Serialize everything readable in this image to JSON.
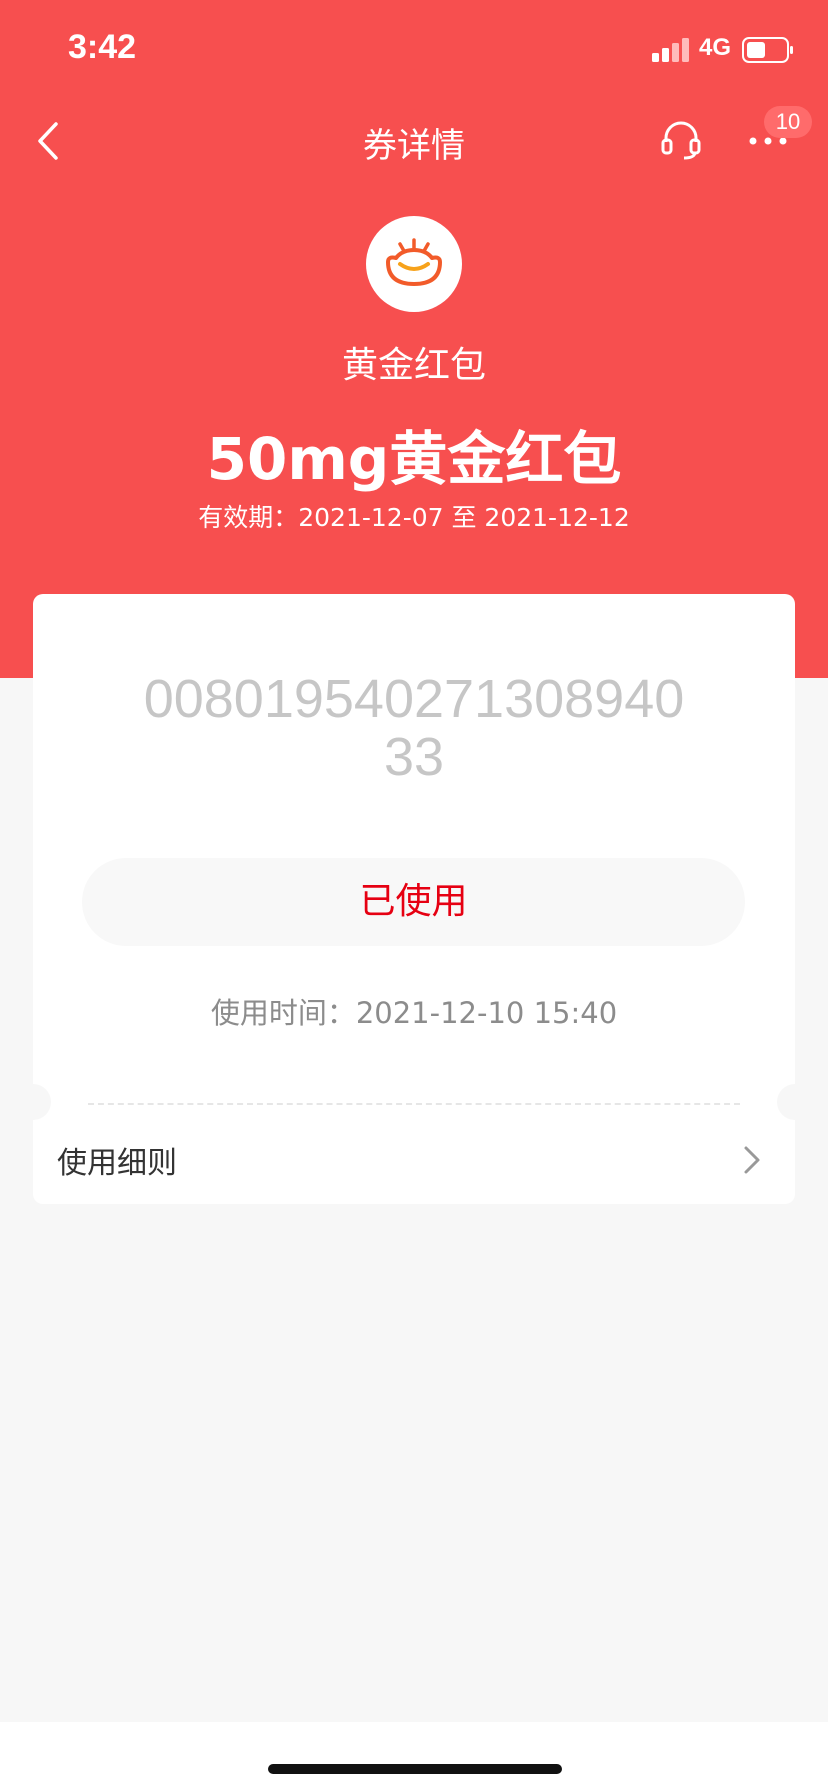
{
  "status_bar": {
    "time": "3:42",
    "network": "4G"
  },
  "nav": {
    "title": "券详情",
    "badge_count": "10"
  },
  "coupon": {
    "brand_name": "黄金红包",
    "title": "50mg黄金红包",
    "validity": "有效期：2021-12-07 至 2021-12-12",
    "code": "00801954027130894033",
    "status": "已使用",
    "use_time": "使用时间：2021-12-10 15:40",
    "rules_label": "使用细则"
  },
  "colors": {
    "header_red": "#f74f4f",
    "status_red": "#e60012",
    "background": "#f7f7f7"
  },
  "icons": {
    "back": "chevron-left-icon",
    "service": "headset-icon",
    "more": "more-dots-icon",
    "brand": "gold-ingot-icon",
    "rules_arrow": "chevron-right-icon"
  }
}
